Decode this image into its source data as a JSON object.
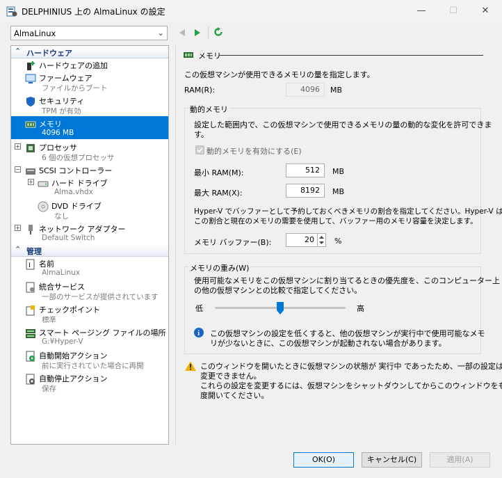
{
  "window": {
    "title": "DELPHINIUS 上の AlmaLinux の設定",
    "minimize": "—",
    "maximize": "☐",
    "close": "✕"
  },
  "vm_selector": {
    "value": "AlmaLinux"
  },
  "tree": {
    "hardware_section": "ハードウェア",
    "management_section": "管理",
    "items": [
      {
        "title": "ハードウェアの追加",
        "sub": ""
      },
      {
        "title": "ファームウェア",
        "sub": "ファイルからブート"
      },
      {
        "title": "セキュリティ",
        "sub": "TPM が有効"
      },
      {
        "title": "メモリ",
        "sub": "4096 MB"
      },
      {
        "title": "プロセッサ",
        "sub": "6 個の仮想プロセッサ"
      },
      {
        "title": "SCSI コントローラー",
        "sub": ""
      },
      {
        "title": "ハード ドライブ",
        "sub": "Alma.vhdx"
      },
      {
        "title": "DVD ドライブ",
        "sub": "なし"
      },
      {
        "title": "ネットワーク アダプター",
        "sub": "Default Switch"
      },
      {
        "title": "名前",
        "sub": "AlmaLinux"
      },
      {
        "title": "統合サービス",
        "sub": "一部のサービスが提供されています"
      },
      {
        "title": "チェックポイント",
        "sub": "標準"
      },
      {
        "title": "スマート ページング ファイルの場所",
        "sub": "G:¥Hyper-V"
      },
      {
        "title": "自動開始アクション",
        "sub": "前に実行されていた場合に再開"
      },
      {
        "title": "自動停止アクション",
        "sub": "保存"
      }
    ]
  },
  "memory": {
    "header": "メモリ",
    "intro": "この仮想マシンが使用できるメモリの量を指定します。",
    "ram_label": "RAM(R):",
    "ram_value": "4096",
    "ram_unit": "MB",
    "dynamic": {
      "legend": "動的メモリ",
      "desc1": "設定した範囲内で、この仮想マシンで使用できるメモリの量の動的な変化を許可できま",
      "desc2": "す。",
      "enable_label": "動的メモリを有効にする(E)",
      "min_label": "最小 RAM(M):",
      "min_value": "512",
      "max_label": "最大 RAM(X):",
      "max_value": "8192",
      "unit": "MB",
      "buffer_desc1": "Hyper-V でバッファーとして予約しておくべきメモリの割合を指定してください。Hyper-V は",
      "buffer_desc2": "この割合と現在のメモリの需要を使用して、バッファー用のメモリ容量を決定します。",
      "buffer_label": "メモリ バッファー(B):",
      "buffer_value": "20",
      "buffer_unit": "%"
    },
    "weight": {
      "legend": "メモリの重み(W)",
      "desc1": "使用可能なメモリをこの仮想マシンに割り当てるときの優先度を、このコンピューター上",
      "desc2": "の他の仮想マシンとの比較で指定してください。",
      "low": "低",
      "high": "高",
      "slider_fraction": 0.5,
      "info1": "この仮想マシンの設定を低くすると、他の仮想マシンが実行中で使用可能なメモ",
      "info2": "リが少ないときに、この仮想マシンが起動されない場合があります。"
    },
    "warning": {
      "line1": "このウィンドウを開いたときに仮想マシンの状態が 実行中 であったため、一部の設定は",
      "line2": "変更できません。",
      "line3": "これらの設定を変更するには、仮想マシンをシャットダウンしてからこのウィンドウをもう一",
      "line4": "度開いてください。"
    }
  },
  "buttons": {
    "ok": "OK(O)",
    "cancel": "キャンセル(C)",
    "apply": "適用(A)"
  },
  "colors": {
    "selection": "#0078d7",
    "accent_green": "#22a14a",
    "warn": "#f0b400",
    "info": "#1a66c2"
  }
}
